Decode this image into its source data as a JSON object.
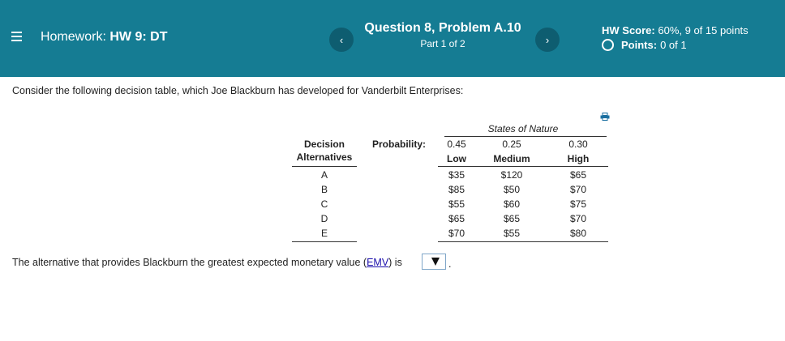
{
  "header": {
    "menu_icon": "hamburger-menu-icon",
    "homework_prefix": "Homework:",
    "homework_name": "HW 9: DT",
    "prev_glyph": "‹",
    "next_glyph": "›",
    "question_title": "Question 8, Problem A.10",
    "part_label": "Part 1 of 2",
    "score_label": "HW Score:",
    "score_value": "60%, 9 of 15 points",
    "points_label": "Points:",
    "points_value": "0 of 1",
    "bar_color": "#157c93"
  },
  "question": {
    "prompt": "Consider the following decision table, which Joe Blackburn has developed for Vanderbilt Enterprises:",
    "print_icon": "print-icon"
  },
  "table": {
    "states_label": "States of Nature",
    "decision_label_1": "Decision",
    "decision_label_2": "Alternatives",
    "probability_label": "Probability:",
    "probabilities": [
      "0.45",
      "0.25",
      "0.30"
    ],
    "states": [
      "Low",
      "Medium",
      "High"
    ],
    "rows": [
      {
        "alt": "A",
        "values": [
          "$35",
          "$120",
          "$65"
        ]
      },
      {
        "alt": "B",
        "values": [
          "$85",
          "$50",
          "$70"
        ]
      },
      {
        "alt": "C",
        "values": [
          "$55",
          "$60",
          "$75"
        ]
      },
      {
        "alt": "D",
        "values": [
          "$65",
          "$65",
          "$70"
        ]
      },
      {
        "alt": "E",
        "values": [
          "$70",
          "$55",
          "$80"
        ]
      }
    ]
  },
  "answer": {
    "text_before": "The alternative that provides Blackburn the greatest expected monetary value (",
    "link_text": "EMV",
    "text_after": ") is",
    "selected_value": "",
    "period": "."
  }
}
